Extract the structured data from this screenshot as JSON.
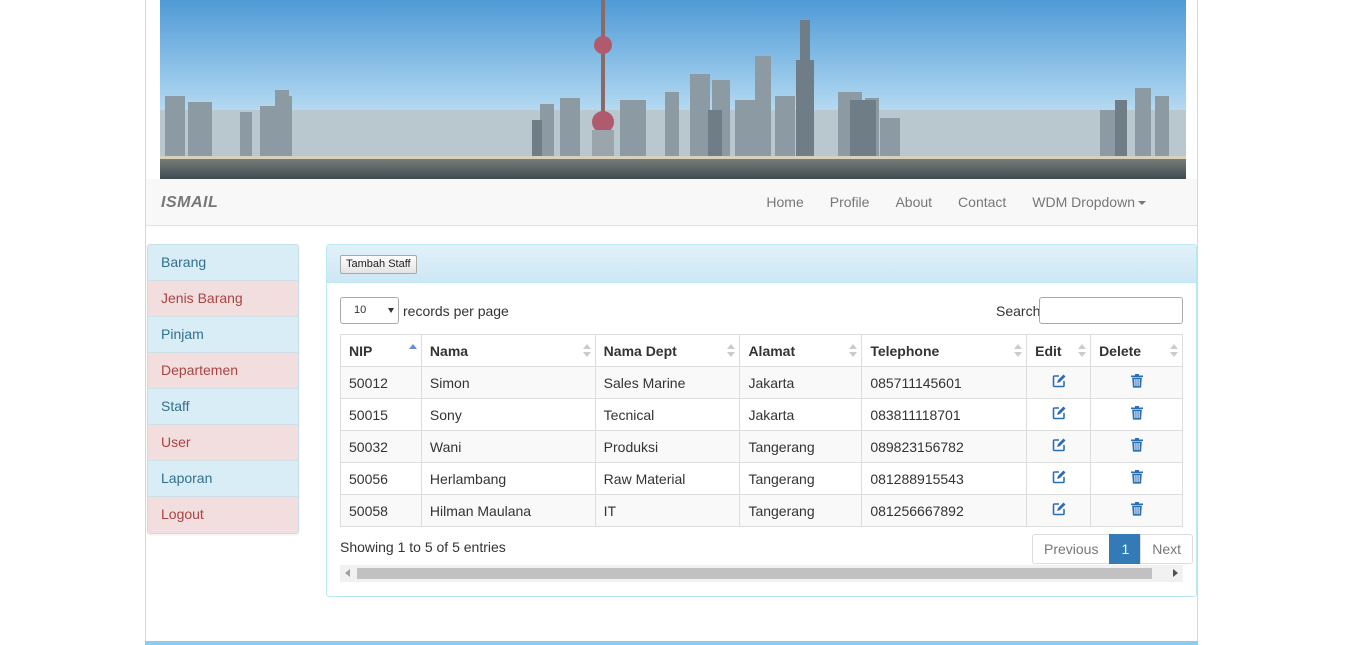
{
  "brand": "ISMAIL",
  "nav": {
    "items": [
      "Home",
      "Profile",
      "About",
      "Contact"
    ],
    "dropdown": "WDM Dropdown"
  },
  "sidebar": {
    "items": [
      {
        "label": "Barang",
        "style": "info"
      },
      {
        "label": "Jenis Barang",
        "style": "danger"
      },
      {
        "label": "Pinjam",
        "style": "info"
      },
      {
        "label": "Departemen",
        "style": "danger"
      },
      {
        "label": "Staff",
        "style": "info"
      },
      {
        "label": "User",
        "style": "danger"
      },
      {
        "label": "Laporan",
        "style": "info"
      },
      {
        "label": "Logout",
        "style": "danger"
      }
    ]
  },
  "panel": {
    "add_button": "Tambah Staff",
    "length_value": "10",
    "length_label": "records per page",
    "search_label": "Search:",
    "search_value": ""
  },
  "table": {
    "columns": [
      "NIP",
      "Nama",
      "Nama Dept",
      "Alamat",
      "Telephone",
      "Edit",
      "Delete"
    ],
    "sorted_column": "NIP",
    "rows": [
      {
        "nip": "50012",
        "nama": "Simon",
        "dept": "Sales Marine",
        "alamat": "Jakarta",
        "telephone": "085711145601"
      },
      {
        "nip": "50015",
        "nama": "Sony",
        "dept": "Tecnical",
        "alamat": "Jakarta",
        "telephone": "083811118701"
      },
      {
        "nip": "50032",
        "nama": "Wani",
        "dept": "Produksi",
        "alamat": "Tangerang",
        "telephone": "089823156782"
      },
      {
        "nip": "50056",
        "nama": "Herlambang",
        "dept": "Raw Material",
        "alamat": "Tangerang",
        "telephone": "081288915543"
      },
      {
        "nip": "50058",
        "nama": "Hilman Maulana",
        "dept": "IT",
        "alamat": "Tangerang",
        "telephone": "081256667892"
      }
    ]
  },
  "footer": {
    "info": "Showing 1 to 5 of 5 entries",
    "previous": "Previous",
    "page": "1",
    "next": "Next"
  },
  "colors": {
    "accent": "#337ab7",
    "icon": "#2a6fb5",
    "info_bg": "#d9edf7",
    "danger_bg": "#f2dede"
  },
  "icons": {
    "edit": "edit-icon",
    "delete": "trash-icon"
  }
}
